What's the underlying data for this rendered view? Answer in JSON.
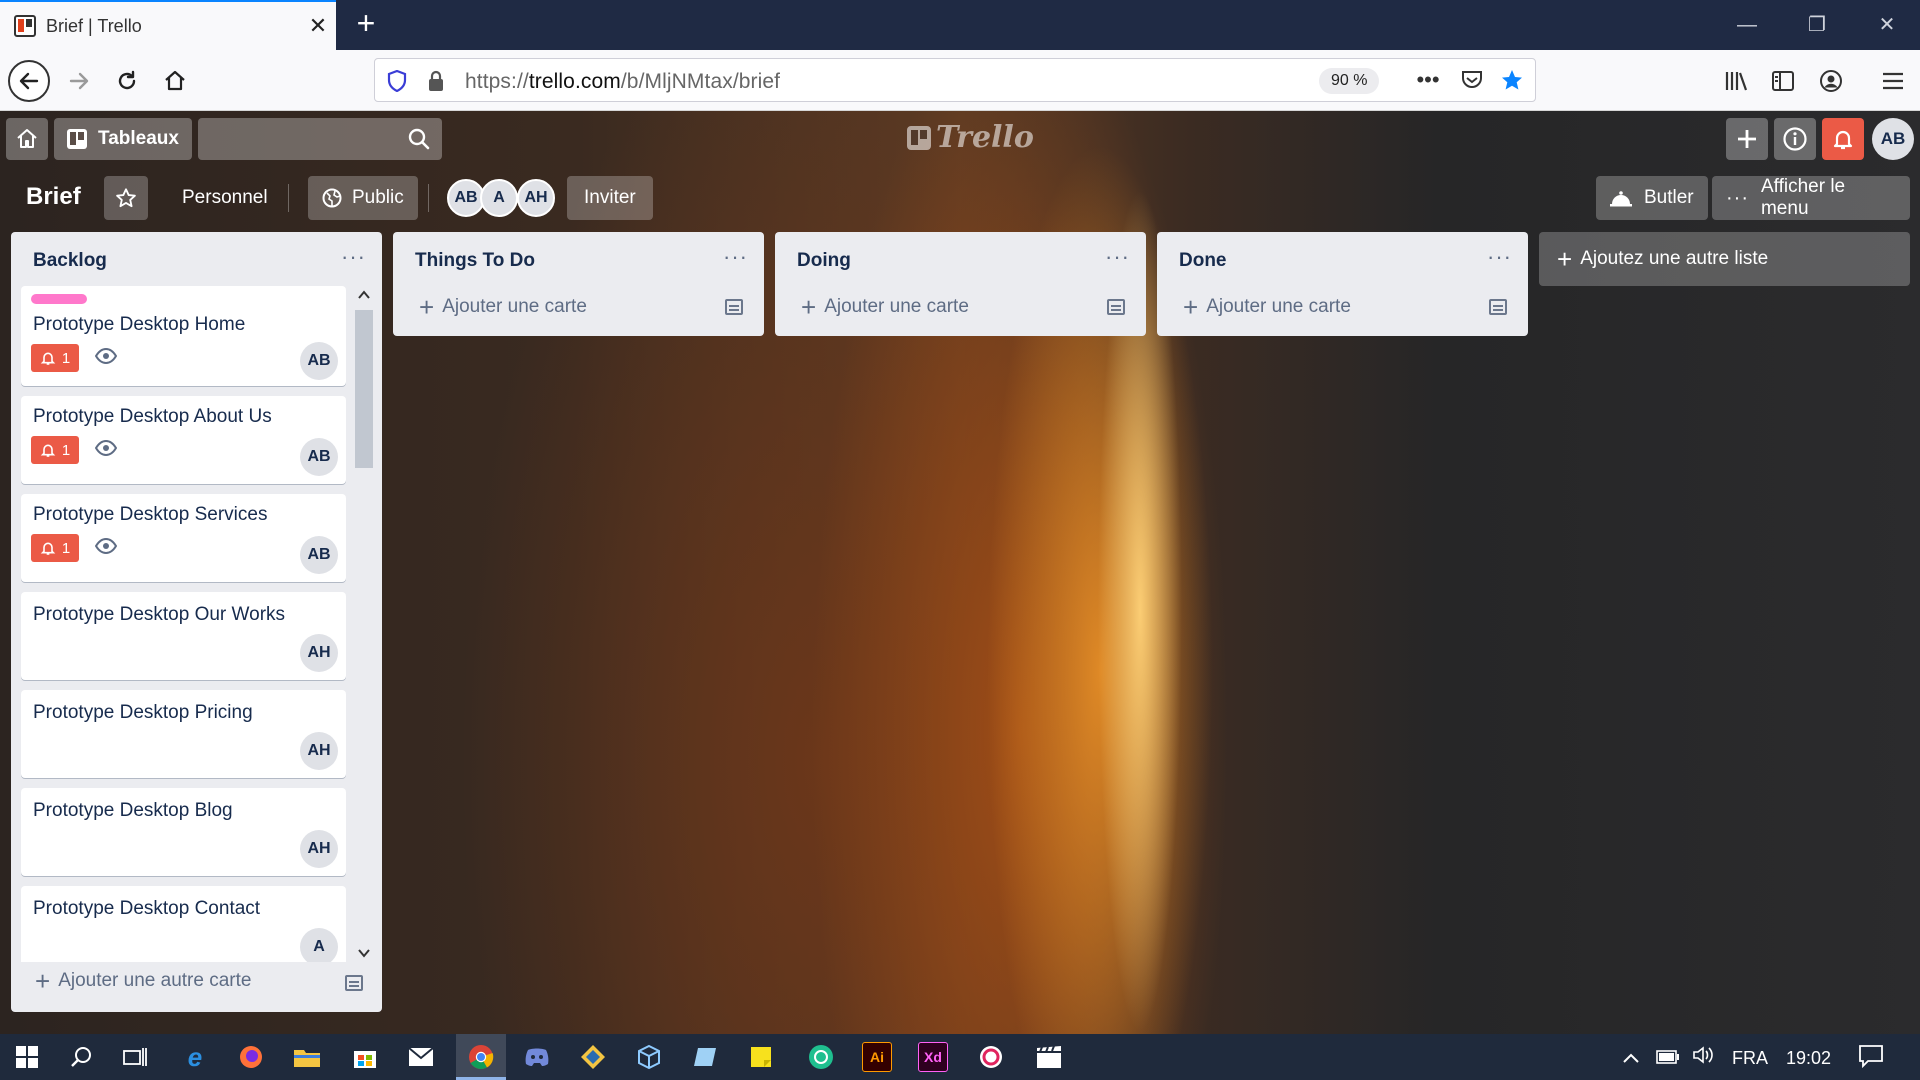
{
  "browser": {
    "tab_title": "Brief | Trello",
    "tab_close": "✕",
    "new_tab": "+",
    "url_prefix": "https://",
    "url_host": "trello.com",
    "url_path": "/b/MljNMtax/brief",
    "zoom": "90 %",
    "window_controls": [
      "—",
      "❐",
      "✕"
    ]
  },
  "trello_header": {
    "boards_label": "Tableaux",
    "logo_text": "Trello",
    "user_initials": "AB"
  },
  "board": {
    "title": "Brief",
    "team": "Personnel",
    "visibility": "Public",
    "members": [
      "AB",
      "A",
      "AH"
    ],
    "invite_label": "Inviter",
    "butler_label": "Butler",
    "menu_label": "Afficher le menu"
  },
  "lists": [
    {
      "title": "Backlog",
      "add_label": "Ajouter une autre carte",
      "cards": [
        {
          "title": "Prototype Desktop Home",
          "badge": "1",
          "member": "AB"
        },
        {
          "title": "Prototype Desktop About Us",
          "badge": "1",
          "member": "AB"
        },
        {
          "title": "Prototype Desktop Services",
          "badge": "1",
          "member": "AB"
        },
        {
          "title": "Prototype Desktop Our Works",
          "member": "AH"
        },
        {
          "title": "Prototype Desktop Pricing",
          "member": "AH"
        },
        {
          "title": "Prototype Desktop Blog",
          "member": "AH"
        },
        {
          "title": "Prototype Desktop Contact",
          "member": "A"
        }
      ]
    },
    {
      "title": "Things To Do",
      "add_label": "Ajouter une carte"
    },
    {
      "title": "Doing",
      "add_label": "Ajouter une carte"
    },
    {
      "title": "Done",
      "add_label": "Ajouter une carte"
    }
  ],
  "add_list_label": "Ajoutez une autre liste",
  "list_menu_glyph": "···",
  "taskbar": {
    "language": "FRA",
    "time": "19:02"
  },
  "colors": {
    "accent": "#0a84ff",
    "label_pink": "#ff78cb",
    "badge_red": "#eb5a46",
    "notification_red": "#eb5a46"
  }
}
